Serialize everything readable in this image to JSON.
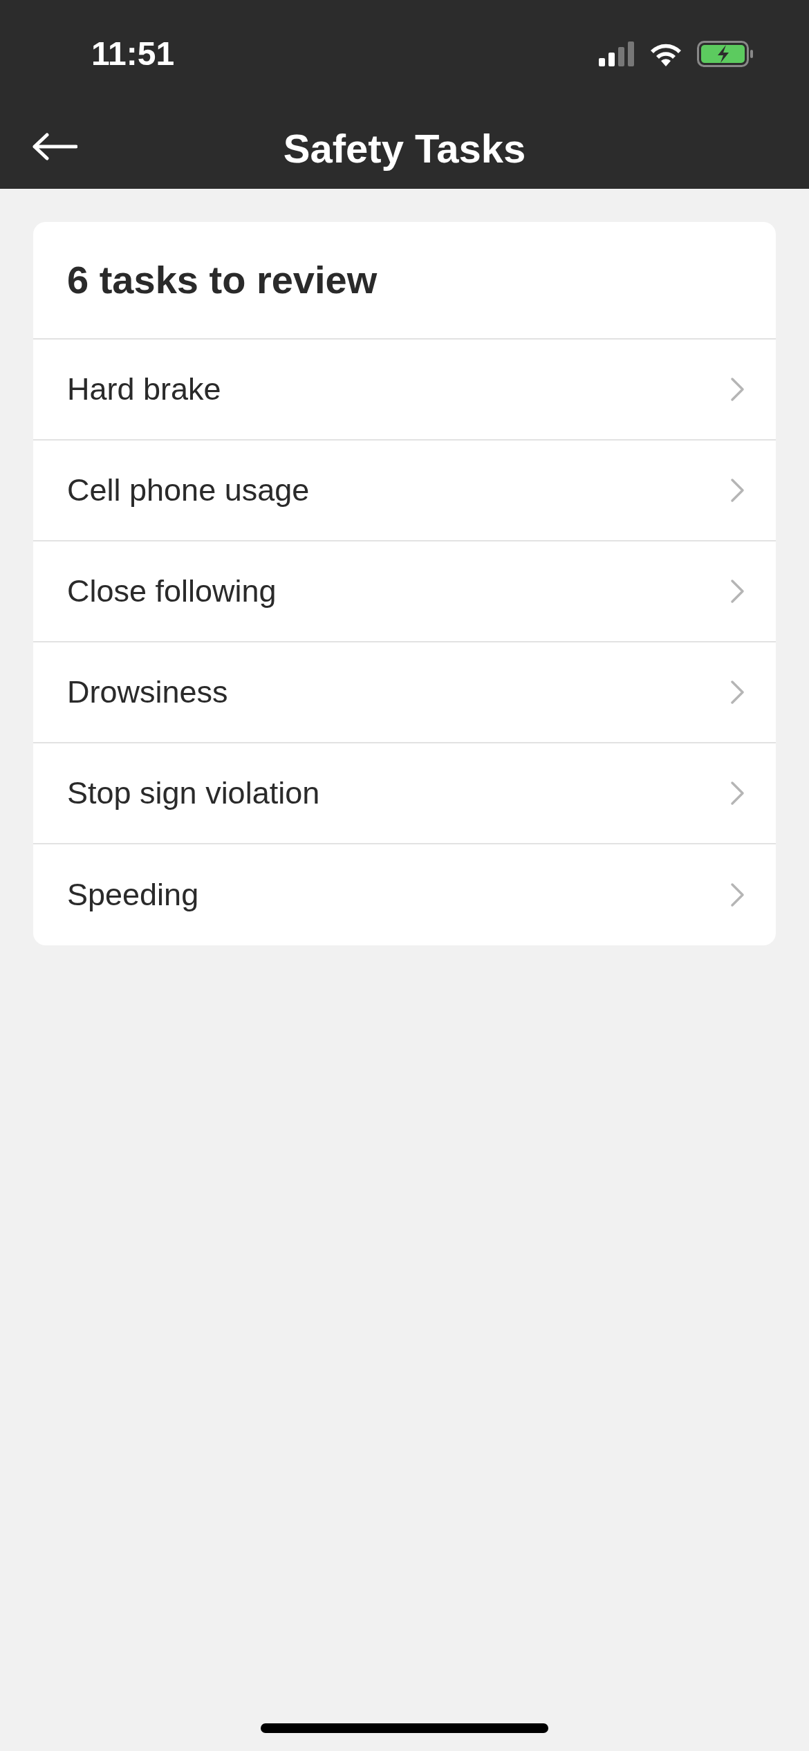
{
  "status_bar": {
    "time": "11:51"
  },
  "nav_bar": {
    "title": "Safety Tasks"
  },
  "card": {
    "heading": "6 tasks to review",
    "items": [
      {
        "label": "Hard brake"
      },
      {
        "label": "Cell phone usage"
      },
      {
        "label": "Close following"
      },
      {
        "label": "Drowsiness"
      },
      {
        "label": "Stop sign violation"
      },
      {
        "label": "Speeding"
      }
    ]
  }
}
